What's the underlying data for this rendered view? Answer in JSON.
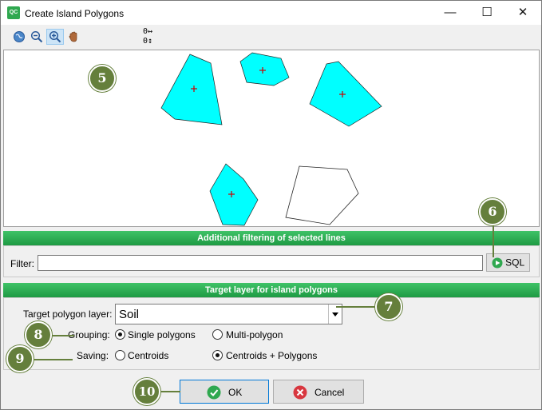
{
  "window": {
    "title": "Create Island Polygons",
    "app_icon": "QC"
  },
  "window_controls": {
    "minimize": "—",
    "maximize": "☐",
    "close": "✕"
  },
  "toolbar": {
    "icons": [
      "globe-icon",
      "zoom-out-icon",
      "zoom-in-icon",
      "pan-hand-icon"
    ],
    "coord_x": "0↔",
    "coord_y": "0↕"
  },
  "filter_section": {
    "header": "Additional filtering of selected lines",
    "filter_label": "Filter:",
    "filter_value": "",
    "sql_button": "SQL"
  },
  "target_section": {
    "header": "Target layer for island polygons",
    "target_label": "Target polygon layer:",
    "target_value": "Soil",
    "grouping_label": "Grouping:",
    "grouping_options": [
      "Single polygons",
      "Multi-polygon"
    ],
    "grouping_selected": "Single polygons",
    "saving_label": "Saving:",
    "saving_options": [
      "Centroids",
      "Centroids + Polygons"
    ],
    "saving_selected": "Centroids + Polygons"
  },
  "buttons": {
    "ok": "OK",
    "cancel": "Cancel"
  },
  "callouts": [
    "5",
    "6",
    "7",
    "8",
    "9",
    "10"
  ],
  "colors": {
    "polygon_fill": "#00ffff",
    "centroid": "#cc0000",
    "header_green": "#2bb055",
    "callout": "#657f3c"
  }
}
